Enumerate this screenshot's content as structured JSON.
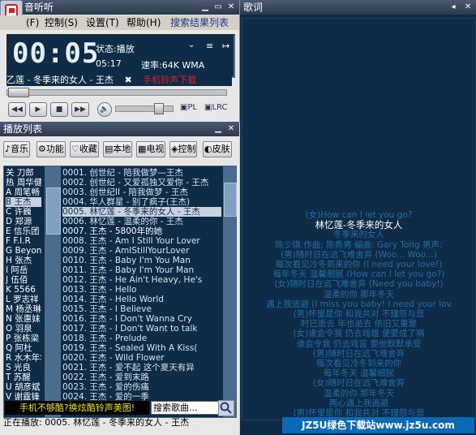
{
  "player": {
    "title": "音听听",
    "menu": [
      "(F)",
      "控制(S)",
      "设置(T)",
      "帮助(H)",
      "搜索结果列表"
    ],
    "time": "00:05",
    "status": "状态:播放",
    "duration": "05:17",
    "bitrate": "速率:64K WMA",
    "song": "乙莲 - 冬季来的女人 - 王杰",
    "alert": "手机铃声下载",
    "pl_label": "PL",
    "lrc_label": "LRC"
  },
  "playlist": {
    "title": "播放列表",
    "tabs": [
      "音乐",
      "功能",
      "收藏",
      "本地",
      "电视",
      "控制",
      "皮肤"
    ],
    "groups": [
      "关 刀郎",
      "热 周华健",
      "A 周笔畅",
      "B 王杰",
      "C 许巍",
      "D 郑源",
      "E 信乐团",
      "F F.I.R",
      "G Beyond",
      "H 张杰",
      "I 阿岳",
      "J 伍佰",
      "K 5566",
      "L 罗志祥",
      "M 杨丞琳",
      "N 张惠妹",
      "O 羽泉",
      "P 张栋梁",
      "Q 阿杜",
      "R 水木年华",
      "S 光良",
      "T 苏醒",
      "U 胡彦斌",
      "V 谢霆锋"
    ],
    "selected_group_index": 3,
    "items": [
      "0001. 创世纪 - 陪我做梦—王杰",
      "0002. 创世纪 - 又爱孤独又爱你 - 王杰",
      "0003. 创世纪II - 陪我做梦 - 王杰",
      "0004. 华人群星 - 别了疯子(王杰)",
      "0005. 林忆莲 - 冬季来的女人 - 王杰",
      "0006. 林忆莲 - 温柔的你 - 王杰",
      "0007. 王杰 - 5800年的她",
      "0008. 王杰 - Am I Still Your Lover",
      "0009. 王杰 - AmIStillYourLover",
      "0010. 王杰 - Baby I'm You Man",
      "0011. 王杰 - Baby I'm Your Man",
      "0012. 王杰 - He Ain't Heavy, He's",
      "0013. 王杰 - Hello",
      "0014. 王杰 - Hello World",
      "0015. 王杰 - I Believe",
      "0016. 王杰 - I Don't Wanna Cry",
      "0017. 王杰 - I Don't Want to talk",
      "0018. 王杰 - Prelude",
      "0019. 王杰 - Sealed With A Kiss(",
      "0020. 王杰 - Wild Flower",
      "0021. 王杰 - 爱不起 这个夏天有异",
      "0022. 王杰 - 爱到末路",
      "0023. 王杰 - 爱的伤痛",
      "0024. 王杰 - 爱的一季"
    ],
    "current_index": 4,
    "promo": "手机不够酷?换炫酷铃声美图!",
    "search_placeholder": "搜索歌曲...",
    "now_playing": "正在播放: 0005. 林忆莲 - 冬季来的女人 - 王杰"
  },
  "lyrics": {
    "title": "歌词",
    "lines": [
      "(女)How can I let you go?",
      "林忆莲-冬季来的女人",
      "冬季来的女人",
      "陈少琪  作曲: 陈秀男  编曲: Gary Tong  男声:",
      "(男)随时日在远飞难舍弃  (Woo...  Woo...)",
      "每次看见冷冬到来的你  (I need your love!)",
      "每年冬天  温馨细腻 (How can I let you go?)",
      "(女)随时日在远飞难舍弃  (Need you baby!)",
      "温柔的你  那年冬天",
      "遇上我逃避  (I miss you baby! I need your lov",
      "(男)怀里是你  和我共对  不理怨与悲",
      "时已逝去  年也逝去  依旧又重聚",
      "(女)谁会令我  仍去戏雄  便要成了祸",
      "谁会令我  仍去戏盲  要他默默承受",
      "(男)随时日在远飞难舍弃",
      "每次看见冷冬到来的你",
      "每年冬天  温馨细腻",
      "(女)随时日在远飞难舍弃",
      "温柔的你  那年冬天",
      "两心遇上我逃避",
      "(男)怀里是你  和我共对  不理怨与悲"
    ],
    "current_index": 1
  },
  "watermark": "JZ5U绿色下载站www.jz5u.com",
  "colors": {
    "panel": "#0e2c47",
    "current_lyric": "#ffffff",
    "lyric": "#1f6fa8",
    "promo_text": "#f2e600"
  }
}
